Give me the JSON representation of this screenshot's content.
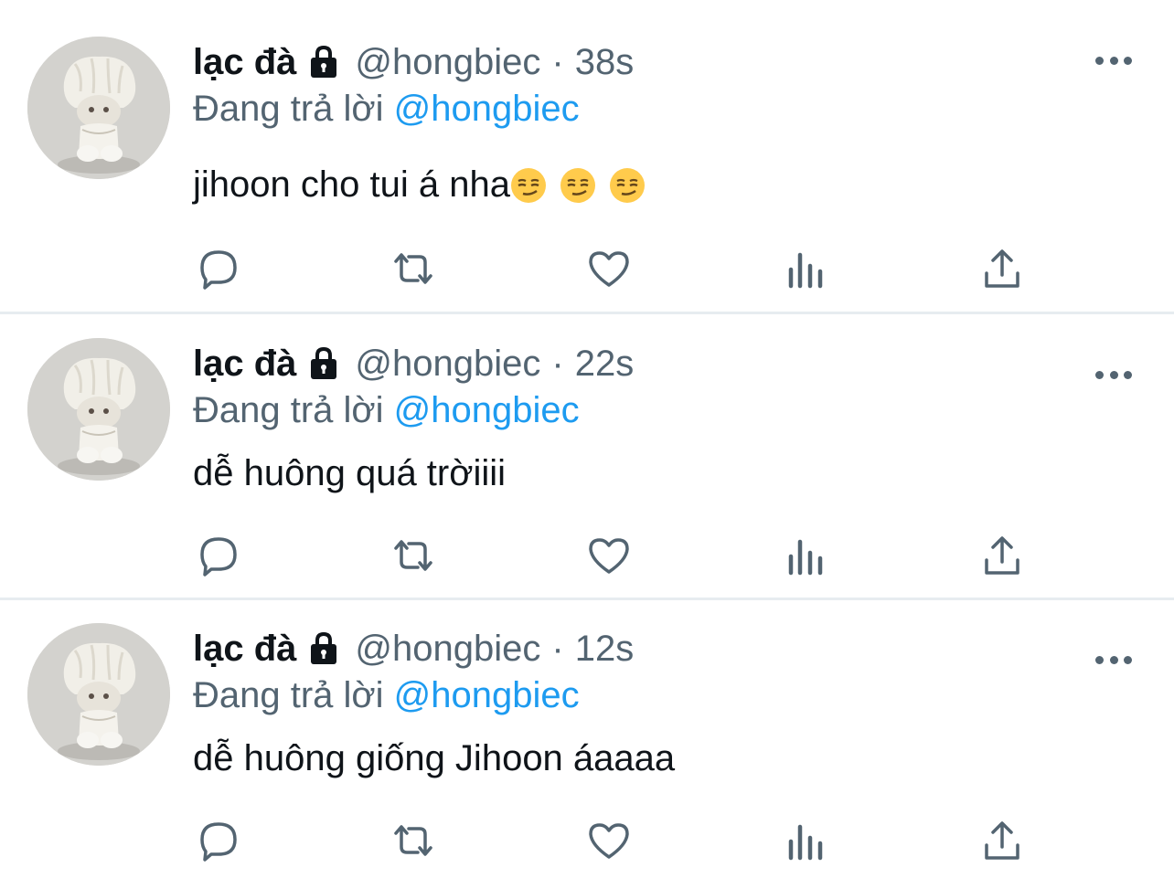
{
  "colors": {
    "text_primary": "#0f1419",
    "text_secondary": "#536471",
    "accent": "#1d9bf0",
    "divider": "#e7ecf0"
  },
  "tweets": [
    {
      "display_name": "lạc đà",
      "handle": "@hongbiec",
      "separator": "·",
      "time": "38s",
      "reply_prefix": "Đang trả lời",
      "reply_to": "@hongbiec",
      "text": "jihoon cho tui á nha",
      "emojis": [
        "smirking-face",
        "smirking-face",
        "smirking-face"
      ]
    },
    {
      "display_name": "lạc đà",
      "handle": "@hongbiec",
      "separator": "·",
      "time": "22s",
      "reply_prefix": "Đang trả lời",
      "reply_to": "@hongbiec",
      "text": "dễ huông quá trờiiii",
      "emojis": []
    },
    {
      "display_name": "lạc đà",
      "handle": "@hongbiec",
      "separator": "·",
      "time": "12s",
      "reply_prefix": "Đang trả lời",
      "reply_to": "@hongbiec",
      "text": "dễ huông giống Jihoon áaaaa",
      "emojis": []
    }
  ],
  "icons": {
    "lock": "lock-icon",
    "more": "more-horizontal-icon",
    "reply": "reply-icon",
    "retweet": "retweet-icon",
    "like": "heart-icon",
    "analytics": "analytics-icon",
    "share": "share-icon"
  }
}
